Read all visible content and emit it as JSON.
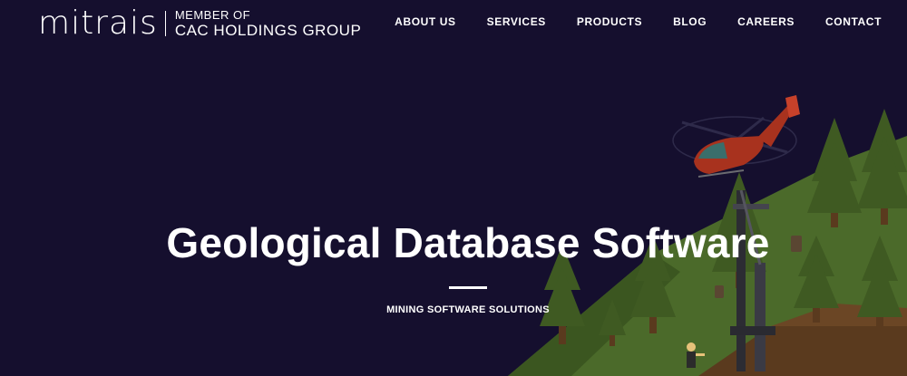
{
  "brand": {
    "wordmark": "mitrais",
    "tagline_line1": "MEMBER OF",
    "tagline_line2": "CAC HOLDINGS GROUP"
  },
  "nav": {
    "items": [
      {
        "label": "ABOUT US"
      },
      {
        "label": "SERVICES"
      },
      {
        "label": "PRODUCTS"
      },
      {
        "label": "BLOG"
      },
      {
        "label": "CAREERS"
      },
      {
        "label": "CONTACT"
      }
    ]
  },
  "hero": {
    "title": "Geological Database Software",
    "subtitle": "MINING SOFTWARE SOLUTIONS",
    "illustration": "mining-drill-helicopter-forest-illustration"
  },
  "colors": {
    "background": "#150f2e",
    "text": "#ffffff",
    "grass": "#4b6a2a",
    "tree": "#3f5a22",
    "helicopter": "#a8321e"
  }
}
